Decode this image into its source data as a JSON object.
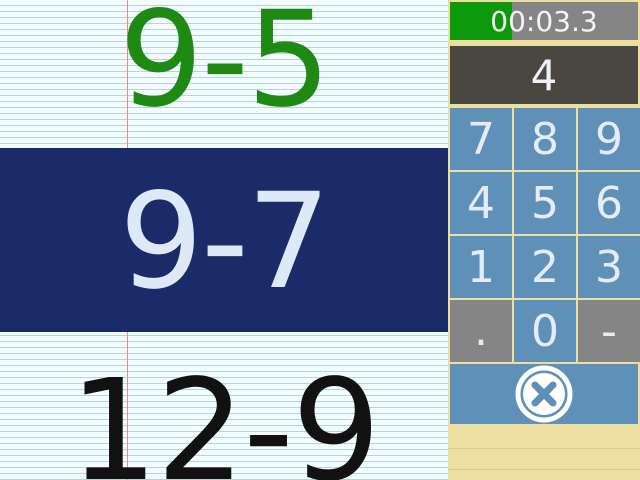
{
  "problems": {
    "previous": "9-5",
    "current": "9-7",
    "next": "12-9"
  },
  "timer": {
    "text": "00:03.3",
    "progress_percent": 33
  },
  "answer": {
    "value": "4"
  },
  "keypad": {
    "keys": [
      "7",
      "8",
      "9",
      "4",
      "5",
      "6",
      "1",
      "2",
      "3",
      ".",
      "0",
      "-"
    ]
  },
  "icons": {
    "clear": "close-circle-icon"
  },
  "colors": {
    "previous_problem": "#1e8a14",
    "current_band": "#1b2a68",
    "current_text": "#dde9f7",
    "next_problem": "#111111",
    "key_blue": "#5e90b8",
    "key_gray": "#858585",
    "timer_green": "#0c9a0c",
    "answer_bg": "#4a4640",
    "panel_bg": "#ecdfa0"
  }
}
